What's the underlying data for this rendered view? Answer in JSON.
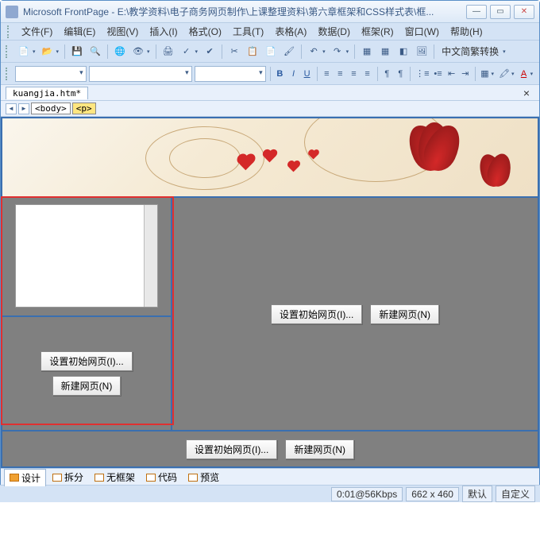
{
  "titlebar": {
    "title": "Microsoft FrontPage - E:\\教学资料\\电子商务网页制作\\上课整理资料\\第六章框架和CSS样式表\\框..."
  },
  "menu": {
    "file": "文件(F)",
    "edit": "编辑(E)",
    "view": "视图(V)",
    "insert": "插入(I)",
    "format": "格式(O)",
    "tools": "工具(T)",
    "table": "表格(A)",
    "data": "数据(D)",
    "frame": "框架(R)",
    "window": "窗口(W)",
    "help": "帮助(H)"
  },
  "toolbar": {
    "convert": "中文简繁转换"
  },
  "format_row": {
    "bold": "B",
    "italic": "I",
    "underline": "U"
  },
  "tabs": {
    "filename": "kuangjia.htm*"
  },
  "tagbar": {
    "body": "<body>",
    "p": "<p>"
  },
  "frame_buttons": {
    "set_initial": "设置初始网页(I)...",
    "new_page": "新建网页(N)"
  },
  "view_tabs": {
    "design": "设计",
    "split": "拆分",
    "noframes": "无框架",
    "code": "代码",
    "preview": "预览"
  },
  "status": {
    "time": "0:01@56Kbps",
    "size": "662 x 460",
    "mode1": "默认",
    "mode2": "自定义"
  }
}
